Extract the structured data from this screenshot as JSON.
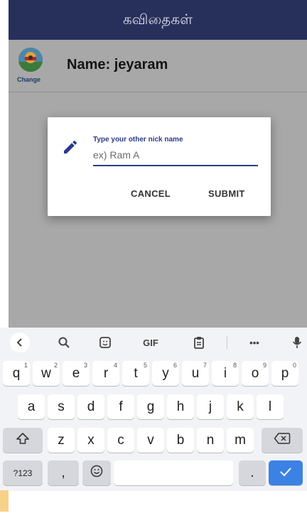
{
  "appbar": {
    "title": "கவிதைகள்"
  },
  "profile": {
    "change_label": "Change",
    "name_text": "Name: jeyaram"
  },
  "dialog": {
    "label": "Type your other nick name",
    "placeholder": "ex) Ram A",
    "cancel_label": "CANCEL",
    "submit_label": "SUBMIT"
  },
  "keyboard": {
    "toolbar": [
      "back-icon",
      "search-icon",
      "sticker-icon",
      "GIF",
      "clipboard-icon",
      "more-icon",
      "mic-icon"
    ],
    "gif_label": "GIF",
    "more_label": "•••",
    "row1": [
      {
        "key": "q",
        "sup": "1"
      },
      {
        "key": "w",
        "sup": "2"
      },
      {
        "key": "e",
        "sup": "3"
      },
      {
        "key": "r",
        "sup": "4"
      },
      {
        "key": "t",
        "sup": "5"
      },
      {
        "key": "y",
        "sup": "6"
      },
      {
        "key": "u",
        "sup": "7"
      },
      {
        "key": "i",
        "sup": "8"
      },
      {
        "key": "o",
        "sup": "9"
      },
      {
        "key": "p",
        "sup": "0"
      }
    ],
    "row2": [
      "a",
      "s",
      "d",
      "f",
      "g",
      "h",
      "j",
      "k",
      "l"
    ],
    "row3": [
      "z",
      "x",
      "c",
      "v",
      "b",
      "n",
      "m"
    ],
    "symbols_label": "?123",
    "comma_label": ",",
    "period_label": ".",
    "colors": {
      "enter": "#3b82e4",
      "appbar": "#27305a",
      "accent": "#2d3a8c"
    }
  }
}
